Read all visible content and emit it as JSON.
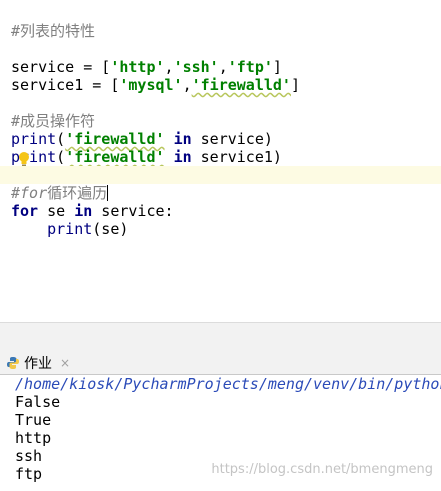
{
  "editor": {
    "line1": "#列表的特性",
    "line3": {
      "a": "service = [",
      "s1": "'http'",
      "c1": ",",
      "s2": "'ssh'",
      "c2": ",",
      "s3": "'ftp'",
      "end": "]"
    },
    "line4": {
      "a": "service1 = [",
      "s1": "'mysql'",
      "c1": ",",
      "s2": "'firewalld'",
      "end": "]"
    },
    "line6": "#成员操作符",
    "line7": {
      "fn": "print",
      "p1": "(",
      "s": "'firewalld'",
      "sp": " ",
      "kw": "in",
      "rest": " service)"
    },
    "line8": {
      "fn": "print",
      "p1": "(",
      "s": "'firewalld'",
      "sp": " ",
      "kw": "in",
      "rest": " service1)"
    },
    "line10": {
      "hash": "#",
      "kw": "for",
      "rest": "循环遍历"
    },
    "line11": {
      "kw1": "for",
      "m1": " se ",
      "kw2": "in",
      "rest": " service:"
    },
    "line12": {
      "indent": "    ",
      "fn": "print",
      "rest": "(se)"
    }
  },
  "run_panel": {
    "tab_label": "作业",
    "close_glyph": "×"
  },
  "console": {
    "path": "/home/kiosk/PycharmProjects/meng/venv/bin/python",
    "lines": [
      "False",
      "True",
      "http",
      "ssh",
      "ftp"
    ]
  },
  "watermark": "https://blog.csdn.net/bmengmeng",
  "colors": {
    "comment": "#808080",
    "string": "#008000",
    "keyword": "#000080",
    "current_line": "#fdfbe3",
    "panel_bg": "#f2f2f2"
  }
}
